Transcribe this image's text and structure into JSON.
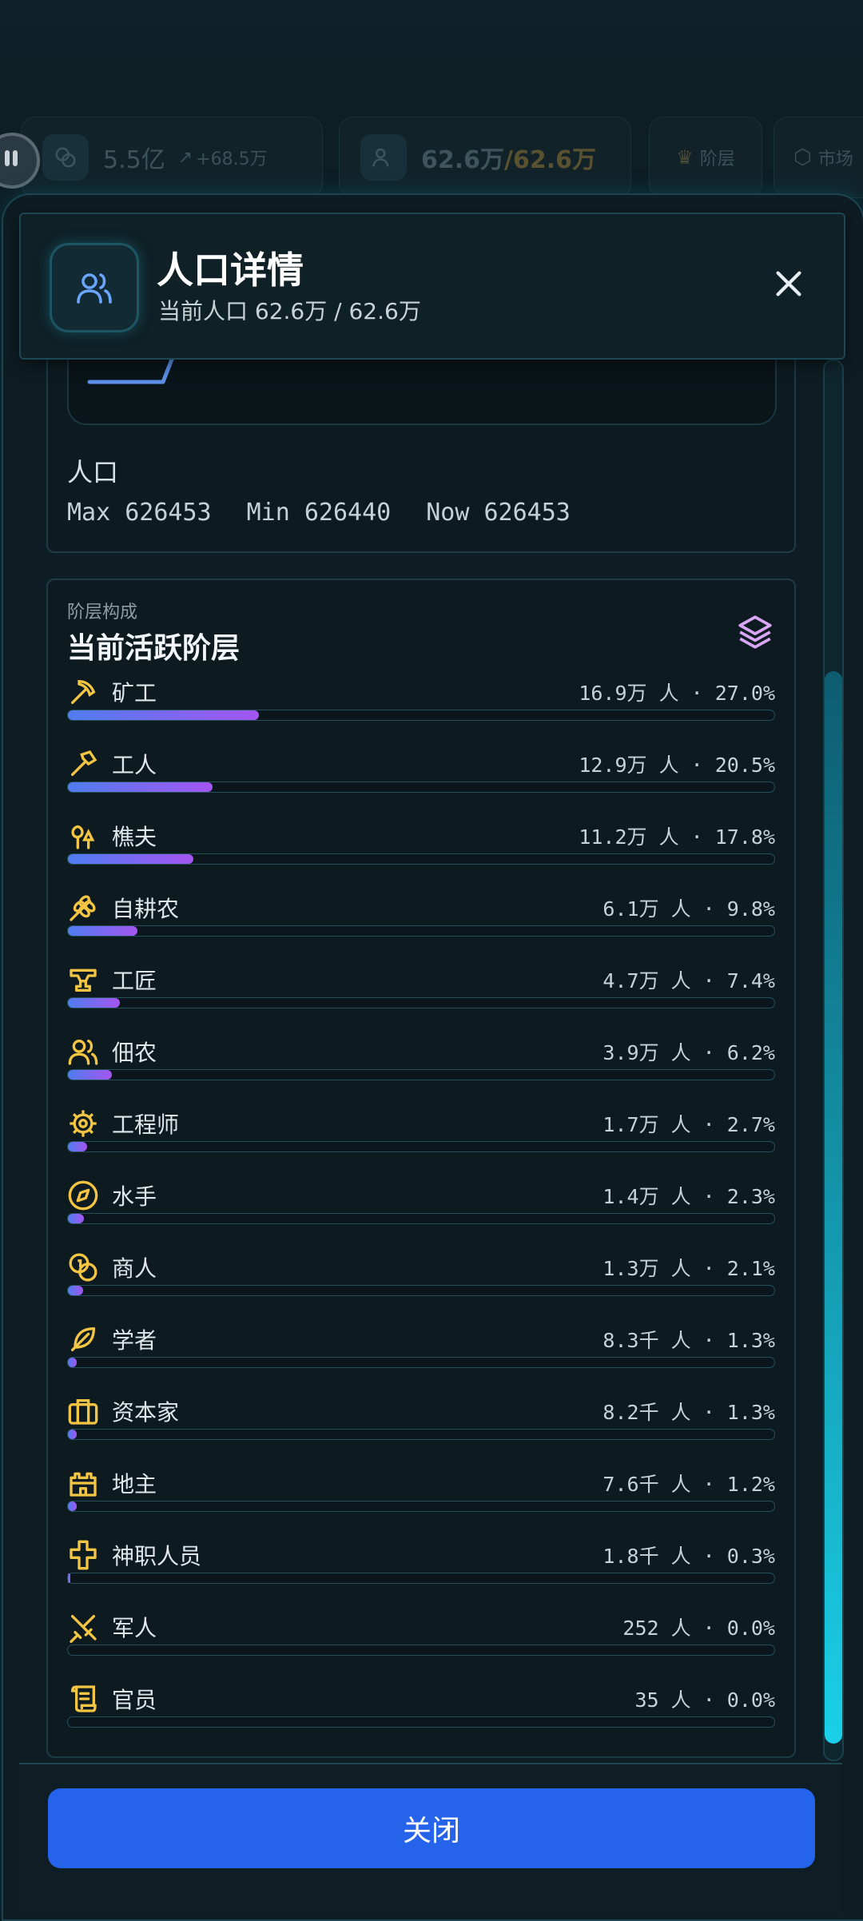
{
  "background": {
    "chip_treasury_value": "5.5亿",
    "chip_treasury_delta": "+68.5万",
    "chip_population_value": "62.6万",
    "chip_population_max": "/62.6万",
    "chip_strata_label": "阶层",
    "chip_market_label": "市场"
  },
  "modal": {
    "title": "人口详情",
    "subtitle": "当前人口 62.6万 / 62.6万",
    "close_label": "关闭"
  },
  "population_card": {
    "label": "人口",
    "max": "Max 626453",
    "min": "Min 626440",
    "now": "Now 626453"
  },
  "strata": {
    "kicker": "阶层构成",
    "title": "当前活跃阶层",
    "items": [
      {
        "name": "矿工",
        "value": "16.9万 人 · 27.0%",
        "share": 27.0,
        "icon": "pickaxe-icon"
      },
      {
        "name": "工人",
        "value": "12.9万 人 · 20.5%",
        "share": 20.5,
        "icon": "hammer-icon"
      },
      {
        "name": "樵夫",
        "value": "11.2万 人 · 17.8%",
        "share": 17.8,
        "icon": "trees-icon"
      },
      {
        "name": "自耕农",
        "value": "6.1万 人 · 9.8%",
        "share": 9.8,
        "icon": "wheat-icon"
      },
      {
        "name": "工匠",
        "value": "4.7万 人 · 7.4%",
        "share": 7.4,
        "icon": "anvil-icon"
      },
      {
        "name": "佃农",
        "value": "3.9万 人 · 6.2%",
        "share": 6.2,
        "icon": "users-icon"
      },
      {
        "name": "工程师",
        "value": "1.7万 人 · 2.7%",
        "share": 2.7,
        "icon": "cog-icon"
      },
      {
        "name": "水手",
        "value": "1.4万 人 · 2.3%",
        "share": 2.3,
        "icon": "compass-icon"
      },
      {
        "name": "商人",
        "value": "1.3万 人 · 2.1%",
        "share": 2.1,
        "icon": "coins-icon"
      },
      {
        "name": "学者",
        "value": "8.3千 人 · 1.3%",
        "share": 1.3,
        "icon": "feather-icon"
      },
      {
        "name": "资本家",
        "value": "8.2千 人 · 1.3%",
        "share": 1.3,
        "icon": "briefcase-icon"
      },
      {
        "name": "地主",
        "value": "7.6千 人 · 1.2%",
        "share": 1.2,
        "icon": "castle-icon"
      },
      {
        "name": "神职人员",
        "value": "1.8千 人 · 0.3%",
        "share": 0.3,
        "icon": "cross-icon"
      },
      {
        "name": "军人",
        "value": "252 人 · 0.0%",
        "share": 0.0,
        "icon": "swords-icon"
      },
      {
        "name": "官员",
        "value": "35 人 · 0.0%",
        "share": 0.0,
        "icon": "scroll-icon"
      }
    ]
  },
  "colors": {
    "accent": "#2563eb",
    "icon_gold": "#f4c542",
    "bar_start": "#4f7df0",
    "bar_end": "#a455f0",
    "scroll": "#1ad0e8"
  }
}
